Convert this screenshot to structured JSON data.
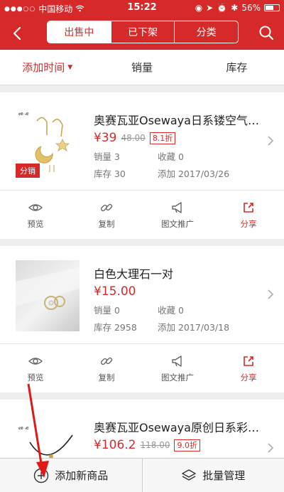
{
  "status": {
    "carrier": "中国移动",
    "time": "15:22",
    "battery": "56%"
  },
  "nav": {
    "tabs": [
      {
        "label": "出售中",
        "active": true
      },
      {
        "label": "已下架"
      },
      {
        "label": "分类"
      }
    ]
  },
  "sort": {
    "items": [
      {
        "label": "添加时间",
        "active": true
      },
      {
        "label": "销量"
      },
      {
        "label": "库存"
      }
    ]
  },
  "products": [
    {
      "title": "奥赛瓦亚Osewaya日系镂空气质…",
      "price": "¥39",
      "old_price": "48.00",
      "discount": "8.1折",
      "tag": "分销",
      "sales": "销量 3",
      "favorites": "收藏 0",
      "stock": "库存 30",
      "added": "添加 2017/03/26"
    },
    {
      "title": "白色大理石一对",
      "price": "¥15.00",
      "sales": "销量 0",
      "favorites": "收藏 0",
      "stock": "库存 2958",
      "added": "添加 2017/03/18"
    },
    {
      "title": "奥赛瓦亚Osewaya原创日系彩钻…",
      "price": "¥106.2",
      "old_price": "118.00",
      "discount": "9.0折"
    }
  ],
  "actions": {
    "preview": "预览",
    "copy": "复制",
    "promo": "图文推广",
    "share": "分享"
  },
  "bottom": {
    "add": "添加新商品",
    "batch": "批量管理"
  },
  "colors": {
    "accent": "#d62a2a"
  }
}
